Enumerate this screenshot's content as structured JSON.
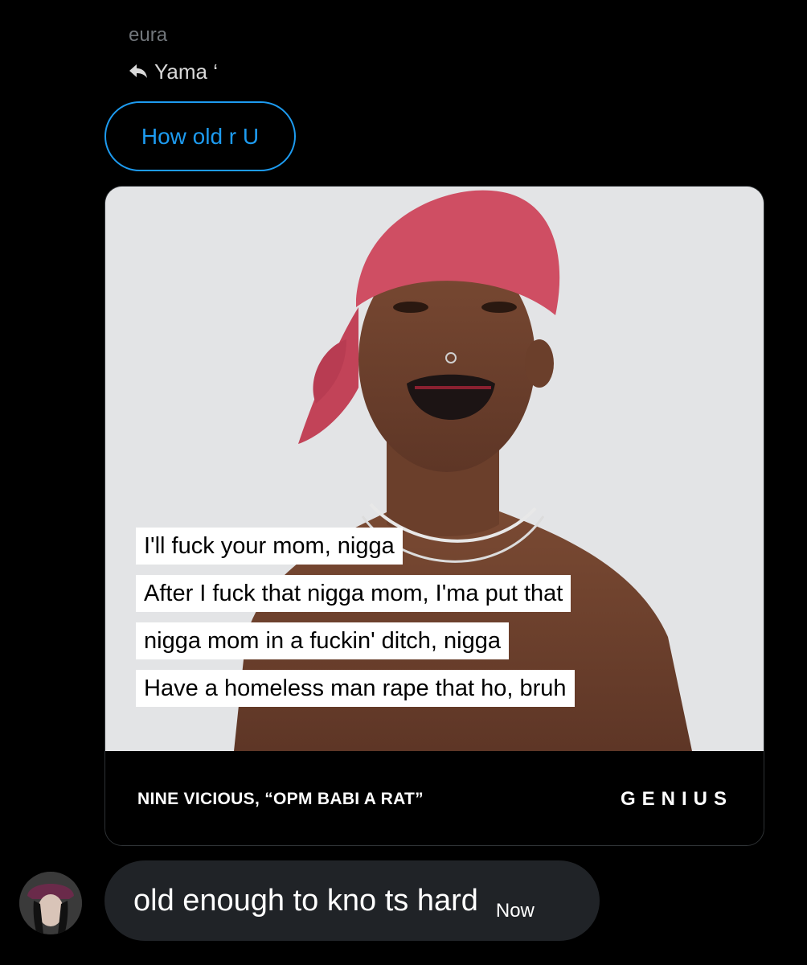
{
  "conversation": {
    "sender_name": "eura",
    "reply_to_label": "Yama ‘",
    "quoted_message": "How old r U"
  },
  "media_card": {
    "lyrics": [
      "I'll fuck your mom, nigga",
      "After I fuck that nigga mom, I'ma put that",
      "nigga mom in a fuckin' ditch, nigga",
      "Have a homeless man rape that ho, bruh"
    ],
    "attribution": "NINE VICIOUS, “OPM BABI A RAT”",
    "brand": "GENIUS"
  },
  "my_message": {
    "text": "old enough to kno ts hard",
    "timestamp": "Now"
  },
  "colors": {
    "background": "#000000",
    "accent": "#1d9bf0",
    "bubble": "#202327",
    "secondary_text": "#71767b"
  },
  "icons": {
    "reply": "reply-arrow-icon"
  }
}
